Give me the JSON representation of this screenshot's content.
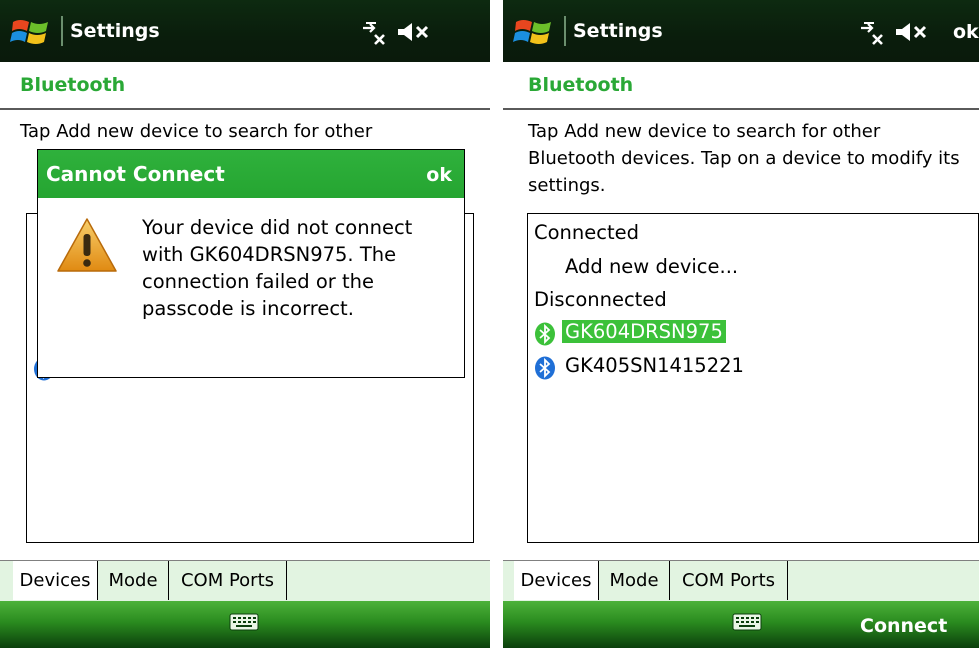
{
  "screens": {
    "left": {
      "title": "Settings",
      "header": "Bluetooth",
      "description_line1": "Tap Add new device to search for other",
      "tabs": [
        "Devices",
        "Mode",
        "COM Ports"
      ],
      "dialog": {
        "title": "Cannot Connect",
        "ok_label": "ok",
        "message": "Your device did not connect with GK604DRSN975. The connection failed or the passcode is incorrect."
      }
    },
    "right": {
      "title": "Settings",
      "ok_label": "ok",
      "header": "Bluetooth",
      "description": "Tap Add new device to search for other Bluetooth devices. Tap on a device to modify its settings.",
      "list": {
        "connected_heading": "Connected",
        "add_device": "Add new device...",
        "disconnected_heading": "Disconnected",
        "devices": [
          "GK604DRSN975",
          "GK405SN1415221"
        ]
      },
      "tabs": [
        "Devices",
        "Mode",
        "COM Ports"
      ],
      "softkey_right": "Connect"
    }
  },
  "colors": {
    "header_green": "#2aa836",
    "selection_green": "#3cc13a",
    "dialog_header": "#2fb13c",
    "bluetooth_blue": "#1f6fd6"
  },
  "icons": [
    "windows-logo-icon",
    "connectivity-icon",
    "volume-muted-icon",
    "bluetooth-icon",
    "warning-icon",
    "keyboard-icon"
  ]
}
